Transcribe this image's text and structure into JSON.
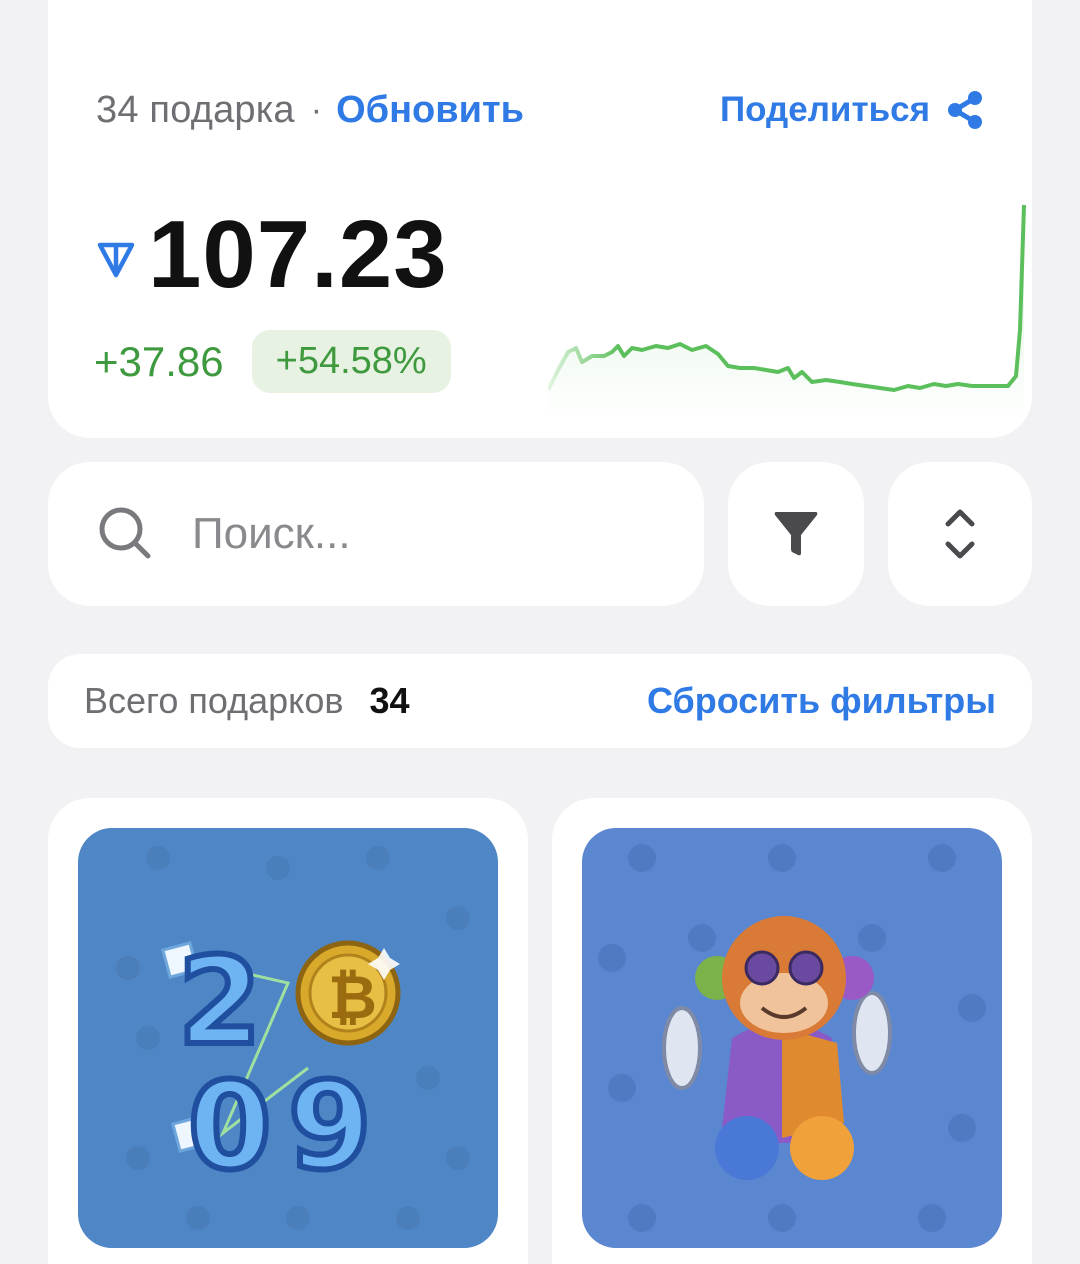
{
  "summary": {
    "gift_count": "34 подарка",
    "separator": "·",
    "refresh_label": "Обновить",
    "share_label": "Поделиться",
    "total_value": "107.23",
    "currency_icon": "ton-icon",
    "change_abs": "+37.86",
    "change_pct": "+54.58%",
    "trend_color": "#5bbf5b"
  },
  "search": {
    "placeholder": "Поиск..."
  },
  "toolbar": {
    "filter_icon": "filter-icon",
    "sort_icon": "sort-icon"
  },
  "totals": {
    "label": "Всего подарков",
    "count": "34",
    "reset_label": "Сбросить фильтры"
  },
  "gifts": [
    {
      "name": "2009 coin gift",
      "icon": "2009-bitcoin-gift-art",
      "background": "#4f86c6"
    },
    {
      "name": "patchwork monkey gift",
      "icon": "toy-monkey-gift-art",
      "background": "#5b86d0"
    }
  ],
  "colors": {
    "accent": "#2f7ae5",
    "positive": "#3f9a3f",
    "positive_bg": "#e7f2e3"
  }
}
